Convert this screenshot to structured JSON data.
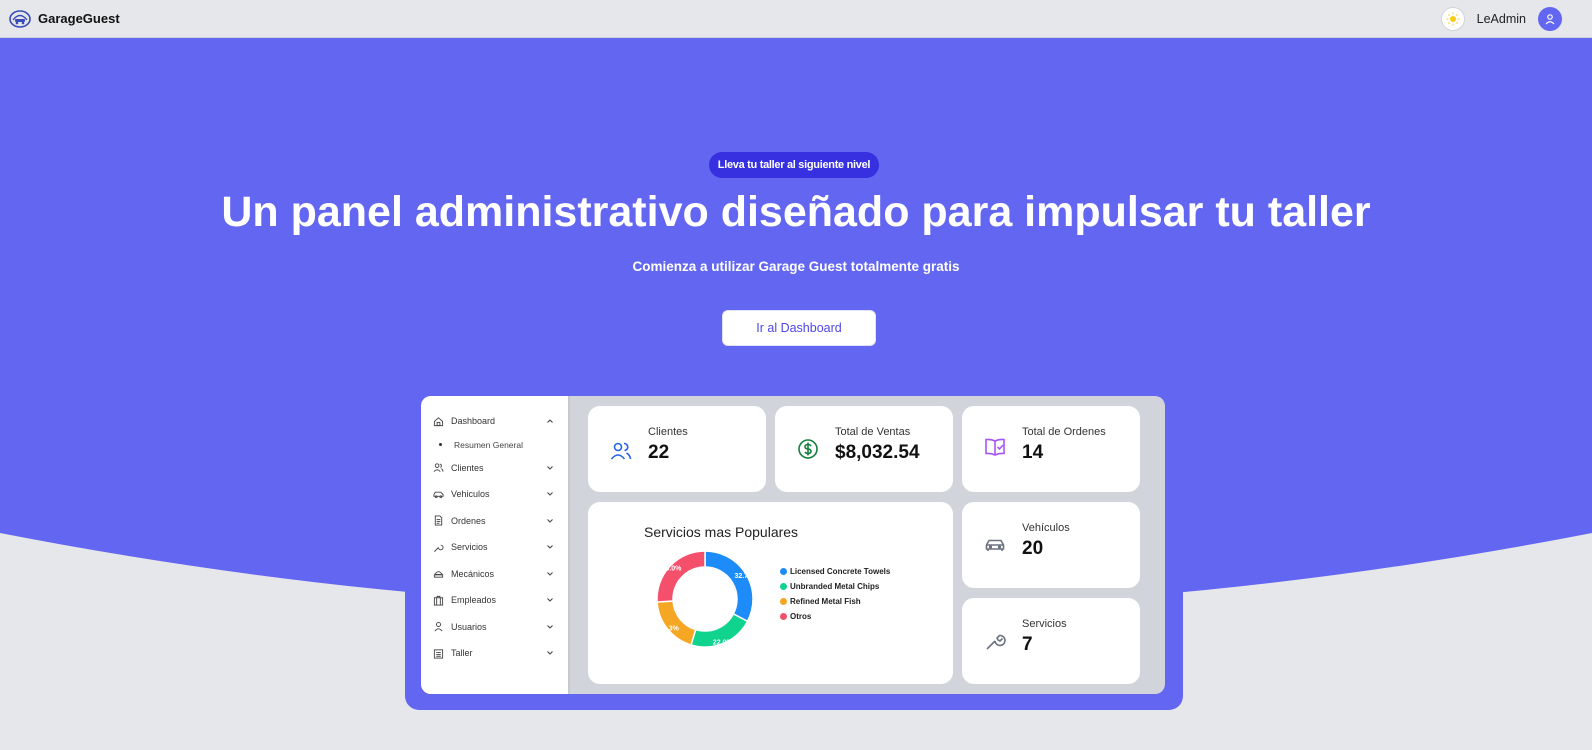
{
  "app": {
    "name": "GarageGuest"
  },
  "nav": {
    "user_name": "LeAdmin"
  },
  "hero": {
    "tagline": "Lleva tu taller al siguiente nivel",
    "headline": "Un panel administrativo diseñado para impulsar tu taller",
    "subline": "Comienza a utilizar Garage Guest totalmente gratis",
    "cta_label": "Ir al Dashboard"
  },
  "sidebar": {
    "dashboard": "Dashboard",
    "dashboard_sub": "Resumen General",
    "items": [
      {
        "label": "Clientes",
        "icon": "users-icon"
      },
      {
        "label": "Vehiculos",
        "icon": "car-icon"
      },
      {
        "label": "Ordenes",
        "icon": "document-icon"
      },
      {
        "label": "Servicios",
        "icon": "wrench-icon"
      },
      {
        "label": "Mecánicos",
        "icon": "mechanic-icon"
      },
      {
        "label": "Empleados",
        "icon": "building-icon"
      },
      {
        "label": "Usuarios",
        "icon": "user-icon"
      },
      {
        "label": "Taller",
        "icon": "garage-icon"
      }
    ]
  },
  "stats": {
    "clientes": {
      "label": "Clientes",
      "value": "22",
      "color": "#2563eb"
    },
    "ventas": {
      "label": "Total de Ventas",
      "value": "$8,032.54",
      "color": "#15803d"
    },
    "ordenes": {
      "label": "Total de Ordenes",
      "value": "14",
      "color": "#a855f7"
    },
    "vehiculos": {
      "label": "Vehículos",
      "value": "20",
      "color": "#6b7280"
    },
    "servicios": {
      "label": "Servicios",
      "value": "7",
      "color": "#6b7280"
    }
  },
  "chart_title": "Servicios mas Populares",
  "chart_data": {
    "type": "pie",
    "title": "Servicios mas Populares",
    "legend_position": "right",
    "categories": [
      "Licensed Concrete Towels",
      "Unbranded Metal Chips",
      "Refined Metal Fish",
      "Otros"
    ],
    "values": [
      32.7,
      22.0,
      19.3,
      26.0
    ],
    "labels": [
      "32.7%",
      "22.0%",
      "19.3%",
      "26.0%"
    ],
    "colors": [
      "#1d8cf8",
      "#10d48e",
      "#f5a623",
      "#f4506b"
    ]
  },
  "colors": {
    "primary": "#6366f1",
    "tagline_bg": "#3730e0"
  }
}
